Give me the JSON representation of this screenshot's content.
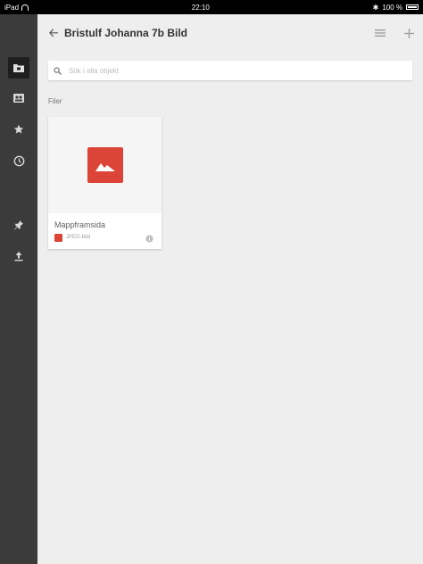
{
  "status_bar": {
    "device": "iPad",
    "time": "22:10",
    "battery": "100 %"
  },
  "header": {
    "title": "Bristulf Johanna 7b Bild",
    "icons": {
      "back": "arrow-left-icon",
      "list": "list-icon",
      "add": "plus-icon"
    }
  },
  "sidebar": {
    "items": [
      {
        "name": "my-drive",
        "icon": "folder-icon",
        "active": true
      },
      {
        "name": "shared",
        "icon": "people-icon",
        "active": false
      },
      {
        "name": "starred",
        "icon": "star-icon",
        "active": false
      },
      {
        "name": "recent",
        "icon": "clock-icon",
        "active": false
      },
      {
        "name": "offline",
        "icon": "pin-icon",
        "active": false
      },
      {
        "name": "uploads",
        "icon": "upload-icon",
        "active": false
      }
    ]
  },
  "search": {
    "placeholder": "Sök i alla objekt"
  },
  "section": {
    "label": "Filer"
  },
  "files": [
    {
      "name": "Mappframsida",
      "type": "JPEG-bild",
      "icon": "image-icon"
    }
  ],
  "colors": {
    "accent": "#db4437",
    "rail": "#3b3b3b",
    "background": "#eeeeee"
  }
}
